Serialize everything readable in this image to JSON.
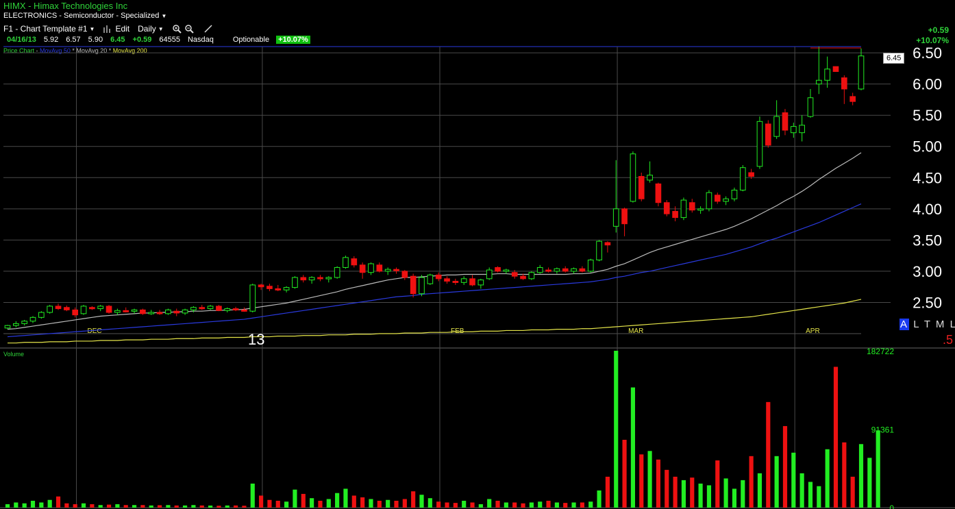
{
  "header": {
    "title": "HIMX - Himax Technologies Inc",
    "industry": "ELECTRONICS - Semiconductor - Specialized",
    "template": "F1 - Chart Template #1",
    "edit_label": "Edit",
    "period": "Daily"
  },
  "quote": {
    "date": "04/16/13",
    "open": "5.92",
    "high": "6.57",
    "low": "5.90",
    "last": "6.45",
    "change": "+0.59",
    "volume": "64555",
    "exchange": "Nasdaq",
    "optionable": "Optionable",
    "pct_change": "+10.07%"
  },
  "top_right": {
    "change": "+0.59",
    "pct_change": "+10.07%"
  },
  "legend": {
    "price": "Price Chart",
    "ma50": "MovAvg 50",
    "ma20": "MovAvg 20",
    "ma200": "MovAvg 200"
  },
  "volume_label": "Volume",
  "last_price_box": "6.45",
  "altml": {
    "a": "A",
    "rest": "L T M L"
  },
  "red_note": ".5",
  "year_label": "13",
  "colors": {
    "up": "#22ee22",
    "down": "#ee1111",
    "ma20": "#bcbcbc",
    "ma50": "#2a3adf",
    "ma200": "#e6e64a",
    "grid": "#4a4a4a",
    "axis_text": "#ffffff"
  },
  "chart_data": [
    {
      "type": "candlestick",
      "title": "Price Chart",
      "ylim": [
        2.0,
        6.6
      ],
      "y_ticks": [
        "2.50",
        "3.00",
        "3.50",
        "4.00",
        "4.50",
        "5.00",
        "5.50",
        "6.00",
        "6.50"
      ],
      "month_labels": [
        "DEC",
        "FEB",
        "MAR",
        "APR"
      ],
      "series_names": [
        "MovAvg 50",
        "MovAvg 20",
        "MovAvg 200"
      ],
      "candles": [
        [
          2.09,
          2.14,
          2.07,
          2.13
        ],
        [
          2.13,
          2.2,
          2.1,
          2.16
        ],
        [
          2.16,
          2.22,
          2.13,
          2.2
        ],
        [
          2.2,
          2.28,
          2.17,
          2.26
        ],
        [
          2.26,
          2.36,
          2.24,
          2.34
        ],
        [
          2.34,
          2.46,
          2.32,
          2.44
        ],
        [
          2.44,
          2.48,
          2.38,
          2.4
        ],
        [
          2.42,
          2.45,
          2.36,
          2.38
        ],
        [
          2.38,
          2.42,
          2.26,
          2.3
        ],
        [
          2.32,
          2.46,
          2.3,
          2.44
        ],
        [
          2.42,
          2.44,
          2.38,
          2.4
        ],
        [
          2.4,
          2.46,
          2.36,
          2.44
        ],
        [
          2.44,
          2.46,
          2.32,
          2.34
        ],
        [
          2.34,
          2.4,
          2.3,
          2.37
        ],
        [
          2.37,
          2.42,
          2.34,
          2.36
        ],
        [
          2.36,
          2.4,
          2.32,
          2.38
        ],
        [
          2.38,
          2.4,
          2.3,
          2.32
        ],
        [
          2.32,
          2.38,
          2.3,
          2.34
        ],
        [
          2.34,
          2.38,
          2.3,
          2.32
        ],
        [
          2.32,
          2.4,
          2.3,
          2.38
        ],
        [
          2.36,
          2.4,
          2.28,
          2.33
        ],
        [
          2.33,
          2.4,
          2.3,
          2.38
        ],
        [
          2.38,
          2.44,
          2.34,
          2.42
        ],
        [
          2.42,
          2.46,
          2.38,
          2.4
        ],
        [
          2.4,
          2.46,
          2.38,
          2.44
        ],
        [
          2.44,
          2.46,
          2.36,
          2.37
        ],
        [
          2.37,
          2.42,
          2.34,
          2.4
        ],
        [
          2.4,
          2.43,
          2.36,
          2.38
        ],
        [
          2.38,
          2.42,
          2.35,
          2.36
        ],
        [
          2.36,
          2.8,
          2.34,
          2.78
        ],
        [
          2.78,
          2.8,
          2.7,
          2.75
        ],
        [
          2.76,
          2.8,
          2.68,
          2.72
        ],
        [
          2.72,
          2.78,
          2.68,
          2.7
        ],
        [
          2.7,
          2.76,
          2.66,
          2.74
        ],
        [
          2.74,
          2.92,
          2.72,
          2.9
        ],
        [
          2.9,
          2.94,
          2.82,
          2.86
        ],
        [
          2.86,
          2.92,
          2.8,
          2.9
        ],
        [
          2.9,
          2.94,
          2.84,
          2.88
        ],
        [
          2.88,
          2.92,
          2.82,
          2.9
        ],
        [
          2.9,
          3.08,
          2.88,
          3.06
        ],
        [
          3.06,
          3.25,
          3.04,
          3.22
        ],
        [
          3.2,
          3.24,
          3.06,
          3.1
        ],
        [
          3.1,
          3.14,
          2.88,
          2.98
        ],
        [
          2.98,
          3.14,
          2.94,
          3.12
        ],
        [
          3.1,
          3.14,
          2.98,
          3.0
        ],
        [
          3.0,
          3.06,
          2.94,
          3.03
        ],
        [
          3.03,
          3.06,
          2.96,
          3.02
        ],
        [
          3.0,
          3.02,
          2.86,
          2.9
        ],
        [
          2.92,
          2.96,
          2.58,
          2.64
        ],
        [
          2.64,
          2.94,
          2.6,
          2.9
        ],
        [
          2.8,
          2.96,
          2.78,
          2.94
        ],
        [
          2.94,
          2.98,
          2.84,
          2.88
        ],
        [
          2.88,
          2.92,
          2.8,
          2.84
        ],
        [
          2.84,
          2.88,
          2.78,
          2.82
        ],
        [
          2.82,
          2.92,
          2.78,
          2.88
        ],
        [
          2.88,
          2.94,
          2.76,
          2.78
        ],
        [
          2.78,
          2.88,
          2.72,
          2.86
        ],
        [
          2.88,
          3.06,
          2.86,
          3.02
        ],
        [
          3.06,
          3.08,
          2.98,
          3.0
        ],
        [
          3.0,
          3.04,
          2.96,
          3.02
        ],
        [
          2.98,
          3.02,
          2.88,
          2.92
        ],
        [
          2.92,
          2.96,
          2.86,
          2.88
        ],
        [
          2.88,
          3.0,
          2.86,
          2.98
        ],
        [
          2.98,
          3.1,
          2.96,
          3.06
        ],
        [
          3.02,
          3.06,
          2.98,
          3.0
        ],
        [
          3.0,
          3.06,
          2.96,
          3.04
        ],
        [
          3.04,
          3.08,
          2.98,
          3.0
        ],
        [
          3.0,
          3.06,
          2.96,
          3.04
        ],
        [
          3.04,
          3.08,
          2.98,
          3.0
        ],
        [
          3.0,
          3.2,
          2.98,
          3.18
        ],
        [
          3.18,
          3.5,
          3.16,
          3.48
        ],
        [
          3.46,
          3.48,
          3.3,
          3.42
        ],
        [
          3.72,
          4.78,
          3.62,
          4.0
        ],
        [
          4.0,
          4.02,
          3.56,
          3.76
        ],
        [
          4.12,
          4.92,
          4.1,
          4.88
        ],
        [
          4.52,
          4.58,
          4.12,
          4.16
        ],
        [
          4.46,
          4.76,
          4.42,
          4.54
        ],
        [
          4.4,
          4.42,
          4.04,
          4.1
        ],
        [
          4.1,
          4.14,
          3.88,
          3.92
        ],
        [
          3.96,
          4.04,
          3.8,
          3.86
        ],
        [
          3.86,
          4.18,
          3.82,
          4.14
        ],
        [
          4.1,
          4.16,
          3.94,
          3.98
        ],
        [
          3.98,
          4.04,
          3.92,
          4.0
        ],
        [
          4.0,
          4.3,
          3.96,
          4.26
        ],
        [
          4.22,
          4.26,
          4.08,
          4.12
        ],
        [
          4.12,
          4.2,
          4.06,
          4.16
        ],
        [
          4.16,
          4.34,
          4.12,
          4.3
        ],
        [
          4.3,
          4.7,
          4.28,
          4.66
        ],
        [
          4.58,
          4.64,
          4.48,
          4.52
        ],
        [
          4.68,
          5.48,
          4.64,
          5.4
        ],
        [
          5.36,
          5.42,
          4.98,
          5.02
        ],
        [
          5.16,
          5.74,
          5.12,
          5.48
        ],
        [
          5.54,
          5.6,
          5.18,
          5.26
        ],
        [
          5.22,
          5.38,
          5.14,
          5.32
        ],
        [
          5.22,
          5.5,
          5.08,
          5.34
        ],
        [
          5.48,
          5.92,
          5.46,
          5.78
        ],
        [
          6.0,
          6.6,
          5.84,
          6.06
        ],
        [
          6.06,
          6.44,
          5.94,
          6.24
        ],
        [
          6.28,
          6.28,
          6.2,
          6.2
        ],
        [
          6.1,
          6.14,
          5.68,
          5.92
        ],
        [
          5.8,
          5.86,
          5.66,
          5.72
        ],
        [
          5.92,
          6.57,
          5.9,
          6.45
        ]
      ],
      "ma20": [
        2.07,
        2.08,
        2.1,
        2.12,
        2.14,
        2.16,
        2.18,
        2.2,
        2.22,
        2.24,
        2.26,
        2.28,
        2.29,
        2.3,
        2.31,
        2.32,
        2.33,
        2.33,
        2.34,
        2.34,
        2.35,
        2.35,
        2.36,
        2.36,
        2.37,
        2.37,
        2.38,
        2.38,
        2.39,
        2.41,
        2.43,
        2.45,
        2.47,
        2.49,
        2.52,
        2.55,
        2.58,
        2.61,
        2.64,
        2.67,
        2.71,
        2.74,
        2.77,
        2.8,
        2.83,
        2.86,
        2.88,
        2.9,
        2.9,
        2.91,
        2.92,
        2.93,
        2.94,
        2.94,
        2.95,
        2.95,
        2.95,
        2.95,
        2.96,
        2.96,
        2.95,
        2.95,
        2.95,
        2.95,
        2.95,
        2.95,
        2.95,
        2.96,
        2.96,
        2.97,
        3.0,
        3.03,
        3.08,
        3.12,
        3.18,
        3.24,
        3.3,
        3.35,
        3.39,
        3.43,
        3.47,
        3.51,
        3.55,
        3.59,
        3.63,
        3.67,
        3.72,
        3.78,
        3.84,
        3.91,
        3.98,
        4.05,
        4.13,
        4.2,
        4.28,
        4.37,
        4.47,
        4.56,
        4.65,
        4.73,
        4.81,
        4.9
      ],
      "ma50": [
        1.95,
        1.96,
        1.97,
        1.98,
        1.99,
        2.0,
        2.01,
        2.02,
        2.03,
        2.04,
        2.05,
        2.06,
        2.07,
        2.08,
        2.09,
        2.1,
        2.11,
        2.12,
        2.13,
        2.14,
        2.15,
        2.16,
        2.17,
        2.18,
        2.19,
        2.2,
        2.21,
        2.22,
        2.23,
        2.25,
        2.27,
        2.29,
        2.31,
        2.33,
        2.35,
        2.37,
        2.39,
        2.41,
        2.43,
        2.45,
        2.47,
        2.49,
        2.51,
        2.53,
        2.55,
        2.57,
        2.59,
        2.6,
        2.61,
        2.63,
        2.64,
        2.65,
        2.66,
        2.67,
        2.68,
        2.69,
        2.7,
        2.71,
        2.72,
        2.73,
        2.74,
        2.75,
        2.76,
        2.77,
        2.78,
        2.79,
        2.8,
        2.81,
        2.82,
        2.83,
        2.85,
        2.87,
        2.9,
        2.92,
        2.95,
        2.98,
        3.0,
        3.03,
        3.06,
        3.09,
        3.12,
        3.15,
        3.18,
        3.21,
        3.24,
        3.27,
        3.31,
        3.35,
        3.39,
        3.44,
        3.49,
        3.53,
        3.58,
        3.63,
        3.68,
        3.73,
        3.78,
        3.84,
        3.9,
        3.96,
        4.02,
        4.08
      ],
      "ma200": [
        1.85,
        1.85,
        1.86,
        1.86,
        1.86,
        1.87,
        1.87,
        1.87,
        1.88,
        1.88,
        1.88,
        1.89,
        1.89,
        1.89,
        1.9,
        1.9,
        1.9,
        1.91,
        1.91,
        1.91,
        1.92,
        1.92,
        1.92,
        1.93,
        1.93,
        1.93,
        1.94,
        1.94,
        1.94,
        1.95,
        1.95,
        1.95,
        1.96,
        1.96,
        1.96,
        1.97,
        1.97,
        1.97,
        1.98,
        1.98,
        1.98,
        1.99,
        1.99,
        1.99,
        2.0,
        2.0,
        2.0,
        2.01,
        2.01,
        2.01,
        2.02,
        2.02,
        2.02,
        2.03,
        2.03,
        2.03,
        2.04,
        2.04,
        2.04,
        2.05,
        2.05,
        2.05,
        2.06,
        2.06,
        2.06,
        2.07,
        2.07,
        2.07,
        2.08,
        2.08,
        2.09,
        2.1,
        2.11,
        2.12,
        2.13,
        2.14,
        2.15,
        2.16,
        2.17,
        2.18,
        2.19,
        2.2,
        2.21,
        2.22,
        2.23,
        2.24,
        2.25,
        2.26,
        2.27,
        2.29,
        2.31,
        2.33,
        2.35,
        2.37,
        2.39,
        2.41,
        2.43,
        2.45,
        2.47,
        2.49,
        2.52,
        2.55
      ]
    },
    {
      "type": "bar",
      "title": "Volume",
      "ylim": [
        0,
        182722
      ],
      "y_ticks": [
        "182722",
        "91361",
        "0"
      ],
      "values": [
        4000,
        6000,
        5000,
        8000,
        6000,
        9000,
        13000,
        5000,
        4000,
        5000,
        4000,
        3000,
        3500,
        4000,
        3000,
        3000,
        3000,
        2500,
        2800,
        3000,
        2500,
        2500,
        3000,
        2500,
        2400,
        2200,
        2500,
        2500,
        2200,
        28000,
        14000,
        9000,
        8000,
        7000,
        21000,
        16000,
        11000,
        8000,
        10000,
        17000,
        22000,
        14000,
        12000,
        10000,
        8000,
        9000,
        8000,
        10000,
        19000,
        15000,
        11000,
        7000,
        6000,
        5500,
        8000,
        6000,
        4000,
        10000,
        8000,
        6000,
        6000,
        5000,
        6000,
        7000,
        8000,
        6000,
        5500,
        6000,
        6000,
        7000,
        20000,
        36000,
        182722,
        79000,
        140000,
        62000,
        66000,
        56000,
        44000,
        36000,
        32000,
        35000,
        28000,
        26000,
        55000,
        34000,
        22000,
        32000,
        60000,
        40000,
        123000,
        60000,
        95000,
        64000,
        40000,
        30000,
        25000,
        68000,
        164000,
        76000,
        36000,
        74000,
        58000,
        90000
      ]
    }
  ]
}
